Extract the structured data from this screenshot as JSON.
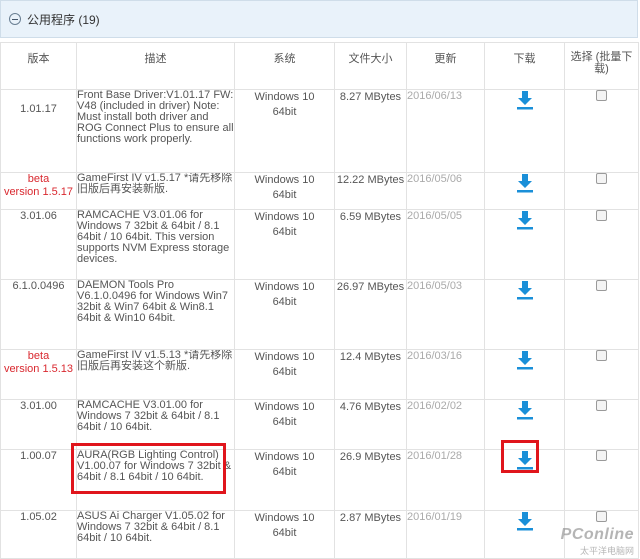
{
  "section": {
    "title": "公用程序 (19)"
  },
  "columns": {
    "version": "版本",
    "description": "描述",
    "system": "系统",
    "size": "文件大小",
    "updated": "更新",
    "download": "下载",
    "select": "选择 (批量下载)"
  },
  "rows": [
    {
      "version_tag": "",
      "version": "1.01.17",
      "description": "Front Base Driver:V1.01.17 FW: V48 (included in driver) Note: Must install both driver and ROG Connect Plus to ensure all functions work properly.",
      "system_line1": "Windows 10",
      "system_line2": "64bit",
      "size": "8.27 MBytes",
      "date": "2016/06/13"
    },
    {
      "version_tag": "beta",
      "version": "version 1.5.17",
      "description": "GameFirst IV v1.5.17 *请先移除旧版后再安装新版.",
      "system_line1": "Windows 10",
      "system_line2": "64bit",
      "size": "12.22 MBytes",
      "date": "2016/05/06"
    },
    {
      "version_tag": "",
      "version": "3.01.06",
      "description": "RAMCACHE V3.01.06 for Windows 7 32bit & 64bit / 8.1 64bit / 10 64bit. This version supports NVM Express storage devices.",
      "system_line1": "Windows 10",
      "system_line2": "64bit",
      "size": "6.59 MBytes",
      "date": "2016/05/05"
    },
    {
      "version_tag": "",
      "version": "6.1.0.0496",
      "description": "DAEMON Tools Pro V6.1.0.0496 for Windows Win7 32bit & Win7 64bit & Win8.1 64bit & Win10 64bit.",
      "system_line1": "Windows 10",
      "system_line2": "64bit",
      "size": "26.97 MBytes",
      "date": "2016/05/03"
    },
    {
      "version_tag": "beta",
      "version": "version 1.5.13",
      "description": "GameFirst IV v1.5.13 *请先移除旧版后再安装这个新版.",
      "system_line1": "Windows 10",
      "system_line2": "64bit",
      "size": "12.4 MBytes",
      "date": "2016/03/16"
    },
    {
      "version_tag": "",
      "version": "3.01.00",
      "description": "RAMCACHE V3.01.00 for Windows 7 32bit & 64bit / 8.1 64bit / 10 64bit.",
      "system_line1": "Windows 10",
      "system_line2": "64bit",
      "size": "4.76 MBytes",
      "date": "2016/02/02"
    },
    {
      "version_tag": "",
      "version": "1.00.07",
      "description": "AURA(RGB Lighting Control) V1.00.07 for Windows 7 32bit & 64bit / 8.1 64bit / 10 64bit.",
      "system_line1": "Windows 10",
      "system_line2": "64bit",
      "size": "26.9 MBytes",
      "date": "2016/01/28"
    },
    {
      "version_tag": "",
      "version": "1.05.02",
      "description": "ASUS Ai Charger V1.05.02 for Windows 7 32bit & 64bit / 8.1 64bit / 10 64bit.",
      "system_line1": "Windows 10",
      "system_line2": "64bit",
      "size": "2.87 MBytes",
      "date": "2016/01/19"
    }
  ],
  "watermark": {
    "brand": "PConline",
    "sub": "太平洋电脑网"
  },
  "colors": {
    "download_icon": "#1a8fd8",
    "beta_text": "#d9282f",
    "highlight": "#e0151c",
    "header_bg": "#e9f2fa"
  },
  "icons": {
    "collapse": "minus-circle-icon",
    "download": "download-arrow-icon"
  }
}
